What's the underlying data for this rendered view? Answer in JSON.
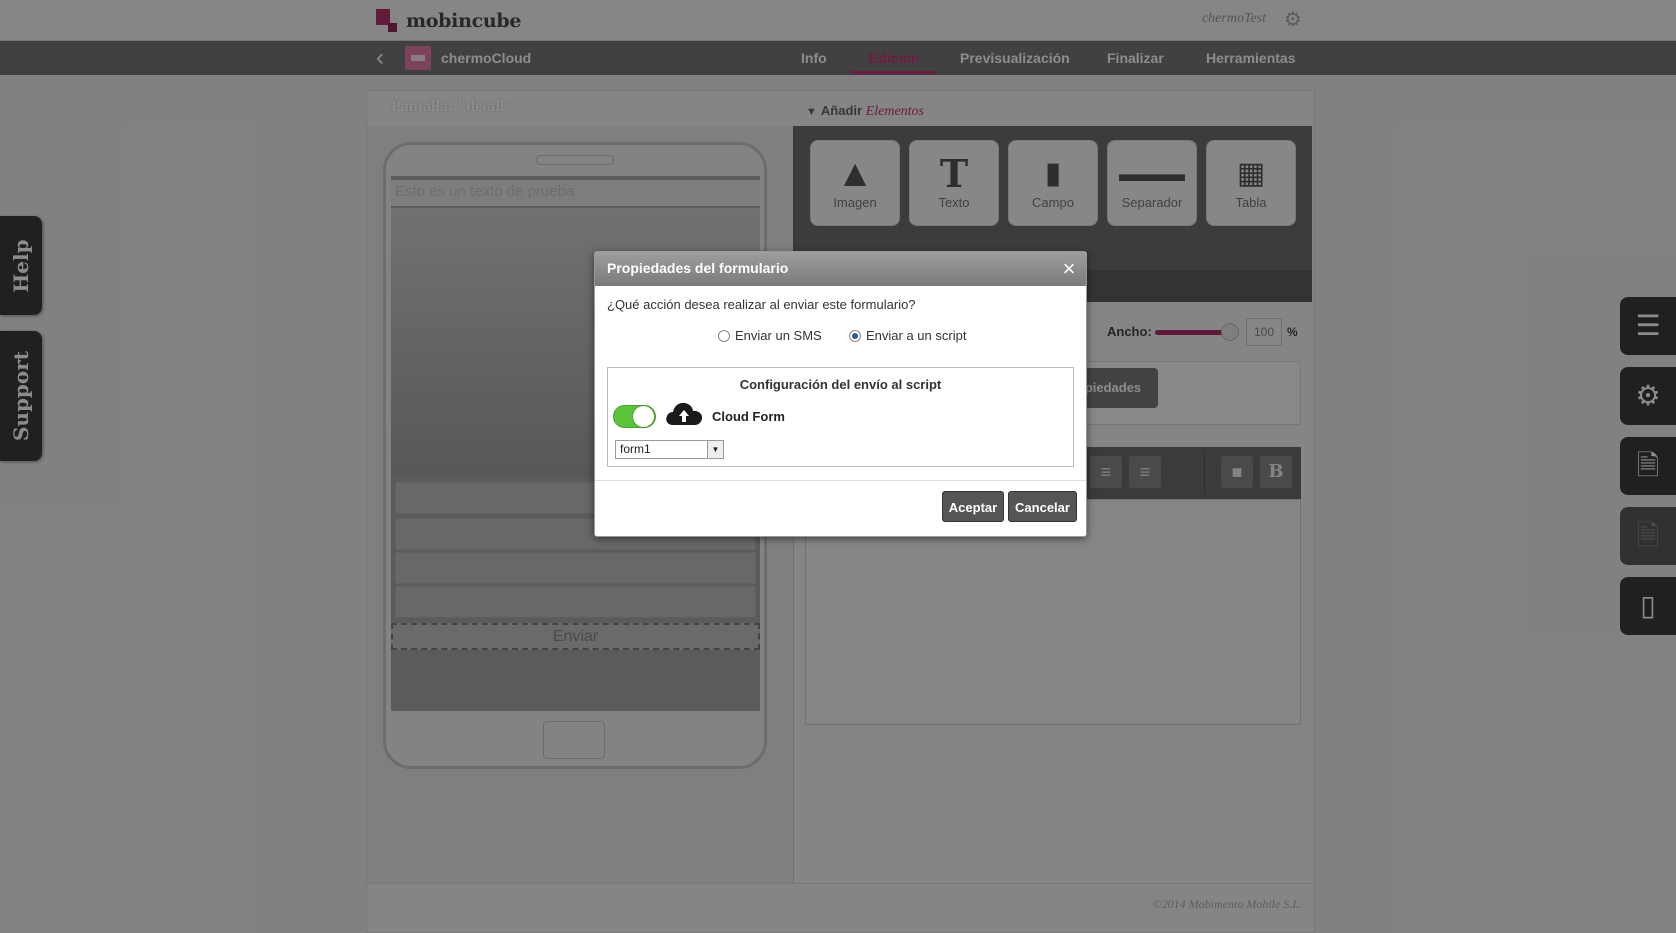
{
  "header": {
    "logo_text": "mobincube",
    "username": "chermoTest",
    "settings_icon": "gear-icon"
  },
  "nav": {
    "app_name": "chermoCloud",
    "tabs": [
      "Info",
      "Edición",
      "Previsualización",
      "Finalizar",
      "Herramientas"
    ],
    "active_tab": "Edición"
  },
  "editor": {
    "screen_title": "Pantalla: \"detail\"",
    "phone": {
      "sample_text": "Esto es un texto de prueba",
      "submit_label": "Enviar"
    },
    "add_elements": {
      "prefix": "Añadir",
      "emphasis": "Elementos"
    },
    "tools": [
      {
        "label": "Imagen",
        "icon": "image-icon"
      },
      {
        "label": "Texto",
        "icon": "text-icon"
      },
      {
        "label": "Campo",
        "icon": "field-icon"
      },
      {
        "label": "Separador",
        "icon": "separator-icon"
      },
      {
        "label": "Tabla",
        "icon": "table-icon"
      }
    ],
    "width": {
      "label": "Ancho:",
      "value": "100",
      "unit": "%",
      "level": 1.0
    },
    "properties_button": "piedades",
    "format_buttons": [
      "align-center-icon",
      "align-right-icon",
      "background-color-icon",
      "bold-icon"
    ],
    "copyright": "©2014 Mobimento Mobile S.L."
  },
  "side_tabs": {
    "help": "Help",
    "support": "Support"
  },
  "right_buttons": [
    "list-icon",
    "settings-icon",
    "page-settings-icon",
    "document-settings-icon",
    "phone-icon"
  ],
  "dialog": {
    "title": "Propiedades del formulario",
    "question": "¿Qué acción desea realizar al enviar este formulario?",
    "options": [
      {
        "label": "Enviar un SMS",
        "selected": false
      },
      {
        "label": "Enviar a un script",
        "selected": true
      }
    ],
    "config_title": "Configuración del envío al script",
    "cloud_form_label": "Cloud Form",
    "cloud_form_enabled": true,
    "form_select_value": "form1",
    "accept": "Aceptar",
    "cancel": "Cancelar"
  },
  "colors": {
    "accent": "#c7337a",
    "toggle_on": "#5cc43a",
    "button_dark": "#555555"
  }
}
